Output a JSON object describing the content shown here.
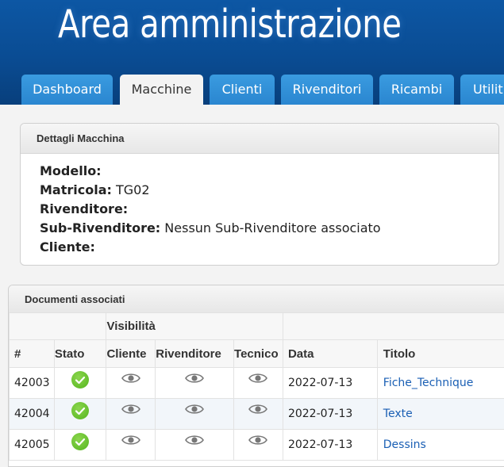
{
  "header": {
    "title": "Area amministrazione",
    "tabs": [
      {
        "label": "Dashboard",
        "active": false
      },
      {
        "label": "Macchine",
        "active": true
      },
      {
        "label": "Clienti",
        "active": false
      },
      {
        "label": "Rivenditori",
        "active": false
      },
      {
        "label": "Ricambi",
        "active": false
      },
      {
        "label": "Utilit",
        "active": false
      }
    ]
  },
  "machine_panel": {
    "title": "Dettagli Macchina",
    "fields": [
      {
        "label": "Modello:",
        "value": ""
      },
      {
        "label": "Matricola:",
        "value": "TG02"
      },
      {
        "label": "Rivenditore:",
        "value": ""
      },
      {
        "label": "Sub-Rivenditore:",
        "value": "Nessun Sub-Rivenditore associato"
      },
      {
        "label": "Cliente:",
        "value": ""
      }
    ]
  },
  "documents_panel": {
    "title": "Documenti associati",
    "group_header": "Visibilità",
    "columns": [
      "#",
      "Stato",
      "Cliente",
      "Rivenditore",
      "Tecnico",
      "Data",
      "Titolo"
    ],
    "rows": [
      {
        "id": "42003",
        "date": "2022-07-13",
        "title": "Fiche_Technique"
      },
      {
        "id": "42004",
        "date": "2022-07-13",
        "title": "Texte"
      },
      {
        "id": "42005",
        "date": "2022-07-13",
        "title": "Dessins"
      }
    ]
  },
  "colors": {
    "header_bg": "#0a4c93",
    "tab_bg": "#2a86d0",
    "link": "#1a5fb4",
    "status_ok": "#5cbb22"
  },
  "icons": {
    "status": "check-circle-icon",
    "visibility": "eye-icon"
  }
}
